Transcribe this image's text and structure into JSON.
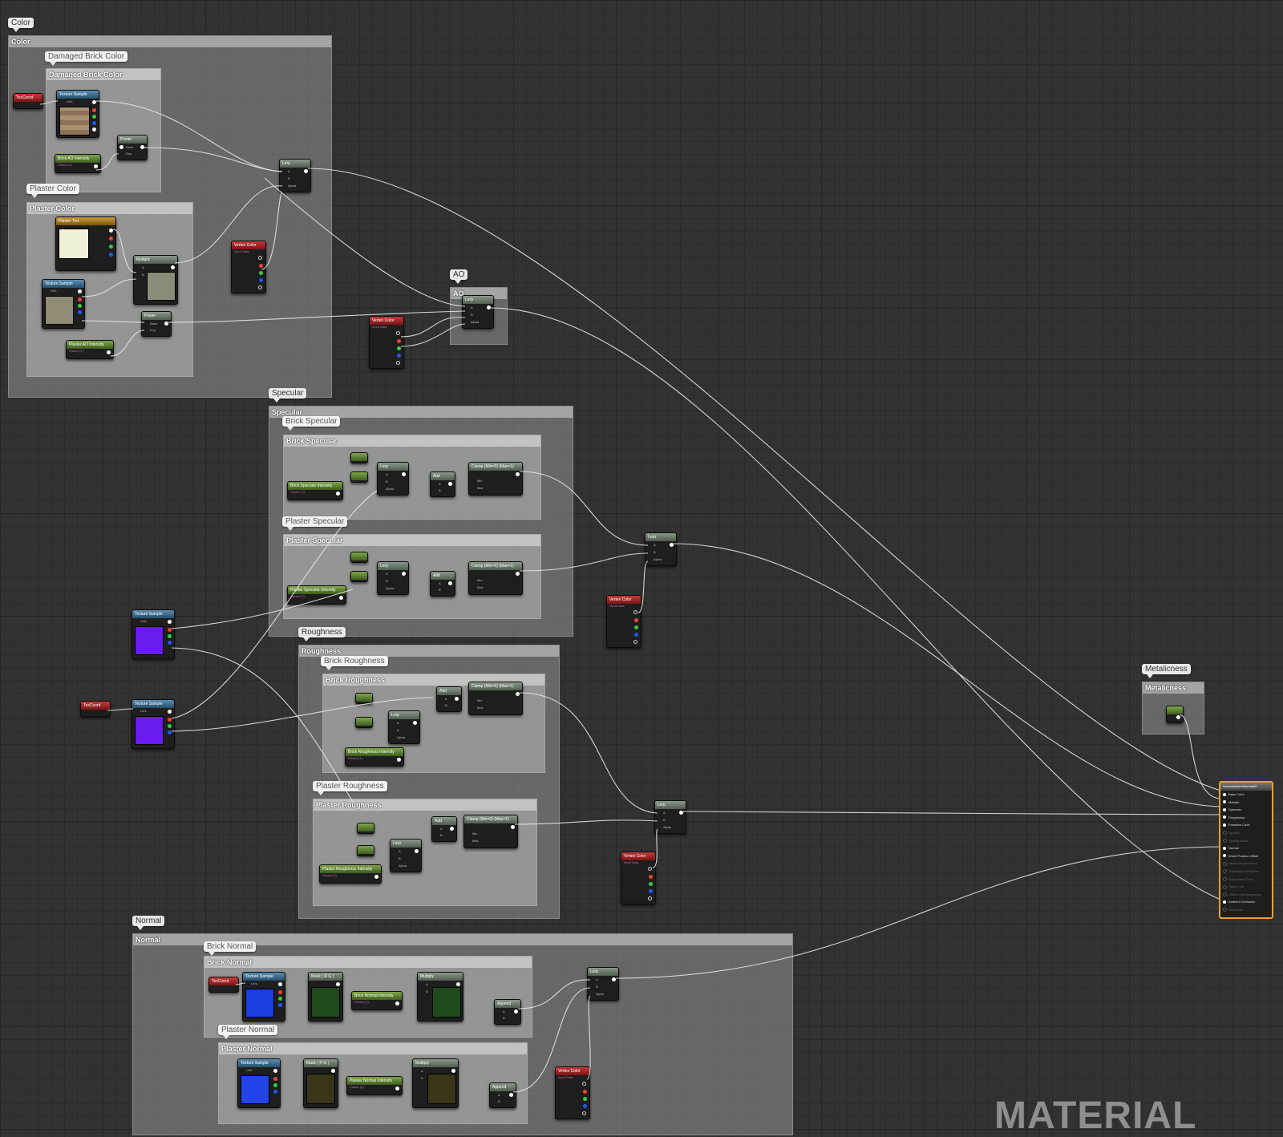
{
  "groups": {
    "color": "Color",
    "damaged_brick_color": "Damaged Brick Color",
    "plaster_color": "Plaster Color",
    "ao": "AO",
    "specular": "Specular",
    "brick_specular": "Brick Specular",
    "plaster_specular": "Plaster Specular",
    "roughness": "Roughness",
    "brick_roughness": "Brick Roughness",
    "plaster_roughness": "Plaster Roughness",
    "metalicness": "Metalicness",
    "normal": "Normal",
    "brick_normal": "Brick Normal",
    "plaster_normal": "Plaster Normal"
  },
  "nodes": {
    "texcoord": "TexCoord",
    "texture_sample": "Texture Sample",
    "uvs": "UVs",
    "power": "Power",
    "base": "Base",
    "exp": "Exp",
    "lerp": "Lerp",
    "a": "A",
    "b": "B",
    "alpha": "Alpha",
    "multiply": "Multiply",
    "add": "Add",
    "append": "Append",
    "clamp": "Clamp (Min=0) (Max=1)",
    "min": "Min",
    "max": "Max",
    "mask": "Mask ( R G )",
    "vertex_color": "Vertex Color",
    "input_data": "Input Data",
    "param": "Param (1)",
    "plaster_tint": "Plaster Tint",
    "brick_ao_intensity": "Brick AO Intensity",
    "plaster_ao_intensity": "Plaster AO Intensity",
    "brick_specular_intensity": "Brick Specular Intensity",
    "plaster_specular_intensity": "Plaster Specular Intensity",
    "brick_roughness_intensity": "Brick Roughness Intensity",
    "plaster_roughness_intensity": "Plaster Roughness Intensity",
    "brick_normal_intensity": "Brick Normal Intensity",
    "plaster_normal_intensity": "Plaster Normal Intensity"
  },
  "output": {
    "title": "HouseMasterMaterial00",
    "pins": [
      {
        "label": "Base Color",
        "active": true
      },
      {
        "label": "Metallic",
        "active": true
      },
      {
        "label": "Specular",
        "active": true
      },
      {
        "label": "Roughness",
        "active": true
      },
      {
        "label": "Emissive Color",
        "active": true
      },
      {
        "label": "Opacity",
        "active": false
      },
      {
        "label": "Opacity Mask",
        "active": false
      },
      {
        "label": "Normal",
        "active": true
      },
      {
        "label": "World Position Offset",
        "active": true
      },
      {
        "label": "World Displacement",
        "active": false
      },
      {
        "label": "Tessellation Multiplier",
        "active": false
      },
      {
        "label": "Subsurface Color",
        "active": false
      },
      {
        "label": "Clear Coat",
        "active": false
      },
      {
        "label": "Clear Coat Roughness",
        "active": false
      },
      {
        "label": "Ambient Occlusion",
        "active": true
      },
      {
        "label": "Refraction",
        "active": false
      }
    ]
  },
  "watermark": "MATERIAL",
  "colors": {
    "background": "#323232",
    "wire": "#e6e6e6",
    "output_border": "#e8a030",
    "texture_header": "#3d6f95",
    "param_header": "#5e8432",
    "vertex_header": "#a02424"
  }
}
